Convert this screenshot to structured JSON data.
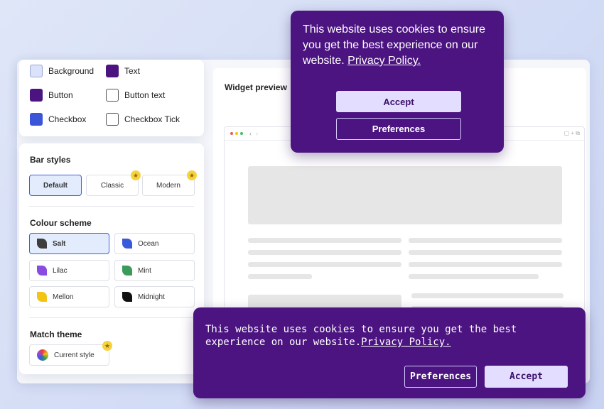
{
  "colours": [
    {
      "label": "Background",
      "color": "#dbe3fb"
    },
    {
      "label": "Text",
      "color": "#4b1480"
    },
    {
      "label": "Button",
      "color": "#4b1480"
    },
    {
      "label": "Button text",
      "color": "#ffffff"
    },
    {
      "label": "Checkbox",
      "color": "#3b55d9"
    },
    {
      "label": "Checkbox Tick",
      "color": "#ffffff"
    }
  ],
  "bar_styles": {
    "title": "Bar styles",
    "options": [
      "Default",
      "Classic",
      "Modern"
    ],
    "selected": "Default"
  },
  "colour_scheme": {
    "title": "Colour scheme",
    "options": [
      {
        "label": "Salt",
        "color": "#3d3d3d"
      },
      {
        "label": "Ocean",
        "color": "#3a5bd9"
      },
      {
        "label": "Lilac",
        "color": "#8a4be0"
      },
      {
        "label": "Mint",
        "color": "#3a9b5a"
      },
      {
        "label": "Mellon",
        "color": "#f2c416"
      },
      {
        "label": "Midnight",
        "color": "#111111"
      }
    ],
    "selected": "Salt"
  },
  "match_theme": {
    "title": "Match theme",
    "option": "Current style"
  },
  "preview": {
    "title": "Widget preview"
  },
  "popup_top": {
    "text": "This website uses cookies to ensure you get the best experience on our website.",
    "link": "Privacy Policy.",
    "accept": "Accept",
    "preferences": "Preferences"
  },
  "popup_bottom": {
    "text": "This website uses cookies to ensure you get the best experience on our website.",
    "link": "Privacy Policy.",
    "preferences": "Preferences",
    "accept": "Accept"
  },
  "colors": {
    "accent": "#3a63d8",
    "popup": "#4b1480",
    "premium_star": "#f6d23f"
  }
}
